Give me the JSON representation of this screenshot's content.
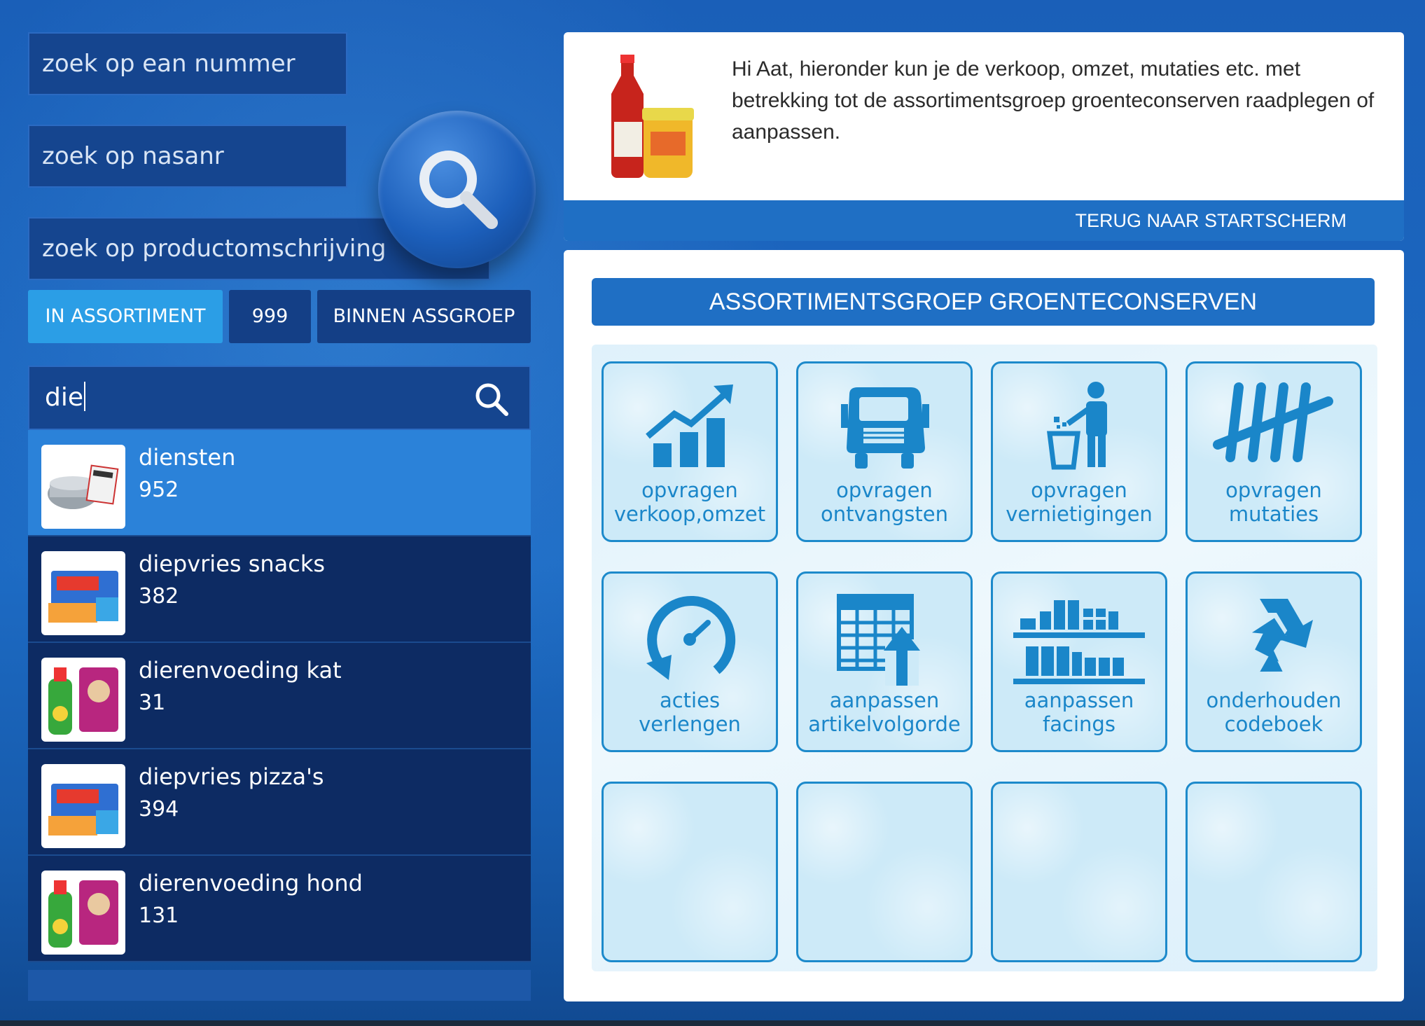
{
  "search": {
    "ean_placeholder": "zoek op ean nummer",
    "nasanr_placeholder": "zoek op nasanr",
    "description_placeholder": "zoek op productomschrijving"
  },
  "filters": {
    "tab_in_assortiment": "IN ASSORTIMENT",
    "tab_count": "999",
    "tab_binnen_assgroep": "BINNEN ASSGROEP",
    "query": "die"
  },
  "results": [
    {
      "name": "diensten",
      "count": "952",
      "thumb": "household-products-thumbnail"
    },
    {
      "name": "diepvries snacks",
      "count": "382",
      "thumb": "frozen-snacks-thumbnail"
    },
    {
      "name": "dierenvoeding kat",
      "count": "31",
      "thumb": "pet-food-thumbnail"
    },
    {
      "name": "diepvries pizza's",
      "count": "394",
      "thumb": "frozen-snacks-thumbnail"
    },
    {
      "name": "dierenvoeding hond",
      "count": "131",
      "thumb": "pet-food-thumbnail"
    }
  ],
  "info": {
    "message": "Hi Aat, hieronder kun je de verkoop, omzet, mutaties etc. met betrekking tot de assortimentsgroep groenteconserven raadplegen of aanpassen.",
    "back_link": "TERUG NAAR STARTSCHERM"
  },
  "group": {
    "title": "ASSORTIMENTSGROEP GROENTECONSERVEN"
  },
  "tiles": [
    {
      "line1": "opvragen",
      "line2": "verkoop,omzet",
      "icon": "sales-chart-icon"
    },
    {
      "line1": "opvragen",
      "line2": "ontvangsten",
      "icon": "truck-icon"
    },
    {
      "line1": "opvragen",
      "line2": "vernietigingen",
      "icon": "trash-person-icon"
    },
    {
      "line1": "opvragen",
      "line2": "mutaties",
      "icon": "tally-icon"
    },
    {
      "line1": "acties",
      "line2": "verlengen",
      "icon": "gauge-icon"
    },
    {
      "line1": "aanpassen",
      "line2": "artikelvolgorde",
      "icon": "table-arrow-icon"
    },
    {
      "line1": "aanpassen",
      "line2": "facings",
      "icon": "shelf-icon"
    },
    {
      "line1": "onderhouden",
      "line2": "codeboek",
      "icon": "recycle-icon"
    }
  ],
  "colors": {
    "accent": "#1f6fc4",
    "tile_icon": "#1a86c9",
    "list_bg": "#0d2b63",
    "list_active": "#2b82d9"
  }
}
